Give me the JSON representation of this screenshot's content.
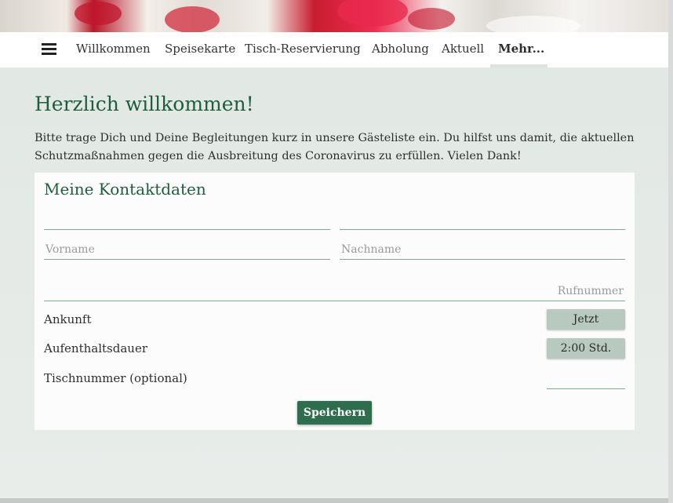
{
  "nav": {
    "menu_icon": "hamburger-menu-icon",
    "items": [
      {
        "label": "Willkommen",
        "active": false
      },
      {
        "label": "Speisekarte",
        "active": false
      },
      {
        "label": "Tisch-Reservierung",
        "active": false
      },
      {
        "label": "Abholung",
        "active": false
      },
      {
        "label": "Aktuell",
        "active": false
      },
      {
        "label": "Mehr...",
        "active": true
      }
    ]
  },
  "page": {
    "title": "Herzlich willkommen!",
    "intro": "Bitte trage Dich und Deine Begleitungen kurz in unsere Gästeliste ein. Du hilfst uns damit, die aktuellen Schutzmaßnahmen gegen die Ausbreitung des Coronavirus zu erfüllen. Vielen Dank!"
  },
  "form": {
    "heading": "Meine Kontaktdaten",
    "vorname_placeholder": "Vorname",
    "nachname_placeholder": "Nachname",
    "phone_placeholder": "Rufnummer",
    "arrival_label": "Ankunft",
    "arrival_value": "Jetzt",
    "duration_label": "Aufenthaltsdauer",
    "duration_value": "2:00 Std.",
    "table_label": "Tischnummer (optional)",
    "save_label": "Speichern"
  },
  "colors": {
    "accent_green": "#1e5e3e",
    "button_green": "#2e6d4d",
    "chip_bg": "#b8c9c0"
  }
}
